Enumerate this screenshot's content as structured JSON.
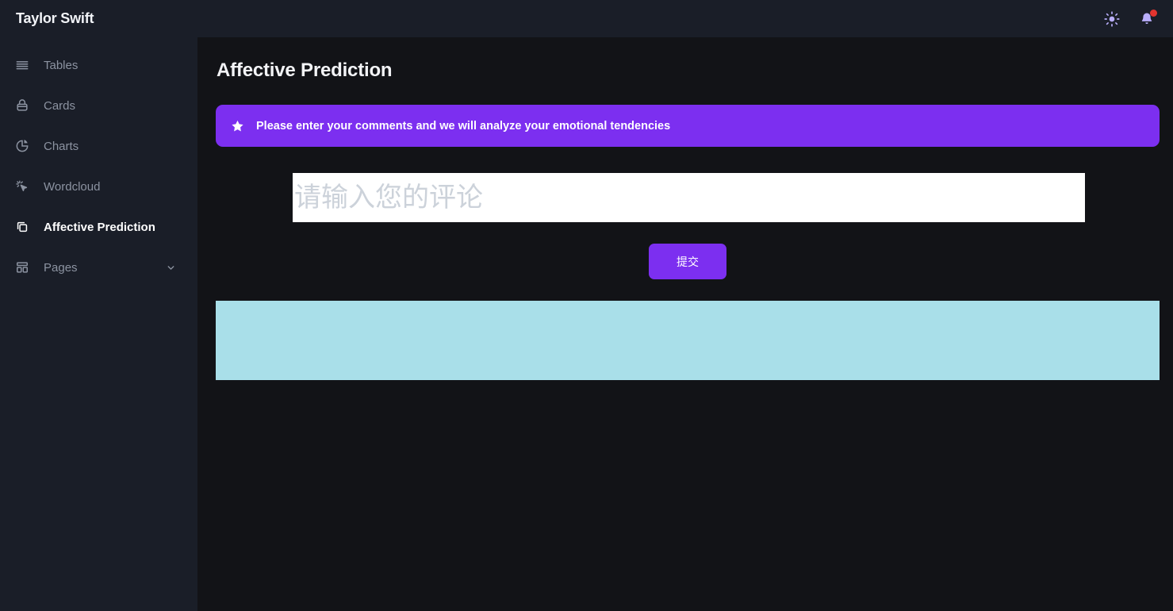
{
  "app": {
    "brand": "Taylor Swift",
    "theme_toggle_icon": "sun-icon",
    "notifications_icon": "bell-icon",
    "has_unread_notifications": true,
    "accent_color": "#7c2ff0",
    "sidebar_bg": "#1a1e28",
    "content_bg": "#121317",
    "result_bg": "#a9dfe9"
  },
  "sidebar": {
    "items": [
      {
        "label": "Tables",
        "icon": "list-lines-icon",
        "active": false,
        "has_chevron": false
      },
      {
        "label": "Cards",
        "icon": "card-box-icon",
        "active": false,
        "has_chevron": false
      },
      {
        "label": "Charts",
        "icon": "pie-chart-icon",
        "active": false,
        "has_chevron": false
      },
      {
        "label": "Wordcloud",
        "icon": "cursor-sparkle-icon",
        "active": false,
        "has_chevron": false
      },
      {
        "label": "Affective Prediction",
        "icon": "copy-layers-icon",
        "active": true,
        "has_chevron": false
      },
      {
        "label": "Pages",
        "icon": "layout-blocks-icon",
        "active": false,
        "has_chevron": true
      }
    ]
  },
  "main": {
    "page_title": "Affective Prediction",
    "alert": {
      "icon": "star-icon",
      "text": "Please enter your comments and we will analyze your emotional tendencies",
      "background": "#7c2ff0"
    },
    "comment_field": {
      "value": "",
      "placeholder": "请输入您的评论"
    },
    "submit_button": {
      "label": "提交"
    },
    "result_panel": {
      "text": "",
      "background": "#a9dfe9"
    }
  }
}
